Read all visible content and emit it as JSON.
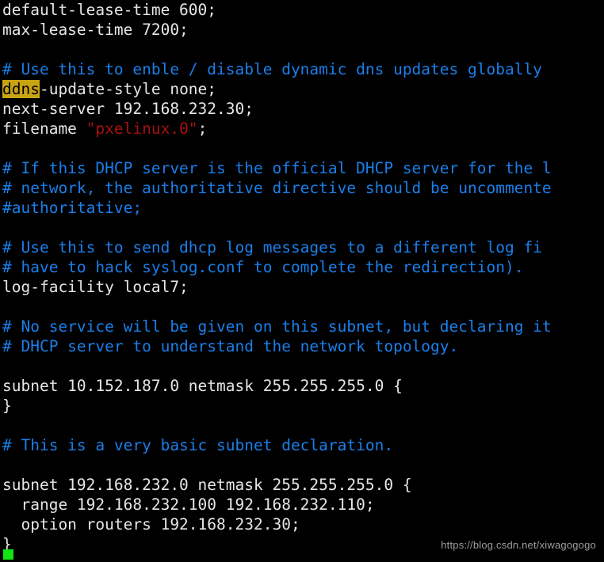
{
  "terminal": {
    "background_color": "#000000",
    "foreground_color": "#e6e6e6",
    "comment_color": "#1a7fea",
    "string_color": "#a61010",
    "highlight_bg_color": "#c8a415",
    "highlight_fg_color": "#000000",
    "cursor_color": "#12e312",
    "cursor_name": "block-cursor"
  },
  "watermark": {
    "text": "https://blog.csdn.net/xiwagogogo"
  },
  "lines": [
    {
      "id": "line-1",
      "segments": [
        {
          "text": "default-lease-time 600;",
          "style": "plain"
        }
      ]
    },
    {
      "id": "line-2",
      "segments": [
        {
          "text": "max-lease-time 7200;",
          "style": "plain"
        }
      ]
    },
    {
      "id": "line-3",
      "segments": [
        {
          "text": "",
          "style": "plain"
        }
      ]
    },
    {
      "id": "line-4",
      "segments": [
        {
          "text": "# Use this to enble / disable dynamic dns updates globally",
          "style": "comment"
        }
      ]
    },
    {
      "id": "line-5",
      "segments": [
        {
          "text": "ddns",
          "style": "highlight"
        },
        {
          "text": "-update-style none;",
          "style": "plain"
        }
      ]
    },
    {
      "id": "line-6",
      "segments": [
        {
          "text": "next-server 192.168.232.30;",
          "style": "plain"
        }
      ]
    },
    {
      "id": "line-7",
      "segments": [
        {
          "text": "filename ",
          "style": "plain"
        },
        {
          "text": "\"pxelinux.0\"",
          "style": "string"
        },
        {
          "text": ";",
          "style": "plain"
        }
      ]
    },
    {
      "id": "line-8",
      "segments": [
        {
          "text": "",
          "style": "plain"
        }
      ]
    },
    {
      "id": "line-9",
      "segments": [
        {
          "text": "# If this DHCP server is the official DHCP server for the l",
          "style": "comment"
        }
      ]
    },
    {
      "id": "line-10",
      "segments": [
        {
          "text": "# network, the authoritative directive should be uncommente",
          "style": "comment"
        }
      ]
    },
    {
      "id": "line-11",
      "segments": [
        {
          "text": "#authoritative;",
          "style": "comment"
        }
      ]
    },
    {
      "id": "line-12",
      "segments": [
        {
          "text": "",
          "style": "plain"
        }
      ]
    },
    {
      "id": "line-13",
      "segments": [
        {
          "text": "# Use this to send dhcp log messages to a different log fi",
          "style": "comment"
        }
      ]
    },
    {
      "id": "line-14",
      "segments": [
        {
          "text": "# have to hack syslog.conf to complete the redirection).",
          "style": "comment"
        }
      ]
    },
    {
      "id": "line-15",
      "segments": [
        {
          "text": "log-facility local7;",
          "style": "plain"
        }
      ]
    },
    {
      "id": "line-16",
      "segments": [
        {
          "text": "",
          "style": "plain"
        }
      ]
    },
    {
      "id": "line-17",
      "segments": [
        {
          "text": "# No service will be given on this subnet, but declaring it",
          "style": "comment"
        }
      ]
    },
    {
      "id": "line-18",
      "segments": [
        {
          "text": "# DHCP server to understand the network topology.",
          "style": "comment"
        }
      ]
    },
    {
      "id": "line-19",
      "segments": [
        {
          "text": "",
          "style": "plain"
        }
      ]
    },
    {
      "id": "line-20",
      "segments": [
        {
          "text": "subnet 10.152.187.0 netmask 255.255.255.0 {",
          "style": "plain"
        }
      ]
    },
    {
      "id": "line-21",
      "segments": [
        {
          "text": "}",
          "style": "plain"
        }
      ]
    },
    {
      "id": "line-22",
      "segments": [
        {
          "text": "",
          "style": "plain"
        }
      ]
    },
    {
      "id": "line-23",
      "segments": [
        {
          "text": "# This is a very basic subnet declaration.",
          "style": "comment"
        }
      ]
    },
    {
      "id": "line-24",
      "segments": [
        {
          "text": "",
          "style": "plain"
        }
      ]
    },
    {
      "id": "line-25",
      "segments": [
        {
          "text": "subnet 192.168.232.0 netmask 255.255.255.0 {",
          "style": "plain"
        }
      ]
    },
    {
      "id": "line-26",
      "segments": [
        {
          "text": "  range 192.168.232.100 192.168.232.110;",
          "style": "plain"
        }
      ]
    },
    {
      "id": "line-27",
      "segments": [
        {
          "text": "  option routers 192.168.232.30;",
          "style": "plain"
        }
      ]
    },
    {
      "id": "line-28",
      "segments": [
        {
          "text": "}",
          "style": "plain"
        }
      ]
    }
  ]
}
